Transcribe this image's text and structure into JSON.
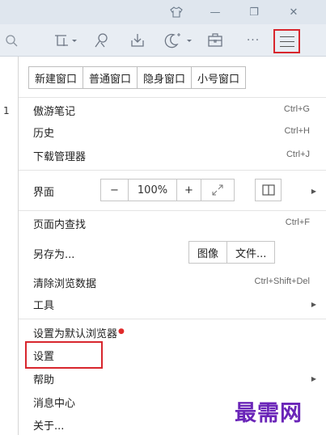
{
  "window_controls": {
    "skin": "皮肤",
    "minimize": "—",
    "restore": "❐",
    "close": "✕"
  },
  "toolbar": {
    "icons": [
      "search-icon",
      "screenshot-icon",
      "person-icon",
      "download-icon",
      "night-mode-icon",
      "toolbox-icon",
      "more-icon",
      "menu-icon"
    ],
    "more_label": "···"
  },
  "menu": {
    "window_buttons": [
      "新建窗口",
      "普通窗口",
      "隐身窗口",
      "小号窗口"
    ],
    "notes": {
      "label": "傲游笔记",
      "shortcut": "Ctrl+G"
    },
    "history": {
      "label": "历史",
      "shortcut": "Ctrl+H"
    },
    "downloads": {
      "label": "下载管理器",
      "shortcut": "Ctrl+J"
    },
    "interface": {
      "label": "界面",
      "zoom_minus": "−",
      "zoom_value": "100%",
      "zoom_plus": "+"
    },
    "find": {
      "label": "页面内查找",
      "shortcut": "Ctrl+F"
    },
    "save_as": {
      "label": "另存为...",
      "image_btn": "图像",
      "file_btn": "文件..."
    },
    "clear_data": {
      "label": "清除浏览数据",
      "shortcut": "Ctrl+Shift+Del"
    },
    "tools": {
      "label": "工具"
    },
    "default_browser": {
      "label": "设置为默认浏览器"
    },
    "settings": {
      "label": "设置"
    },
    "help": {
      "label": "帮助"
    },
    "messages": {
      "label": "消息中心"
    },
    "about": {
      "label": "关于..."
    }
  },
  "left_fragment": "1",
  "watermark": "最需网",
  "colors": {
    "highlight": "#d8262d",
    "watermark": "#6a25b8",
    "toolbar": "#e8edf3"
  }
}
